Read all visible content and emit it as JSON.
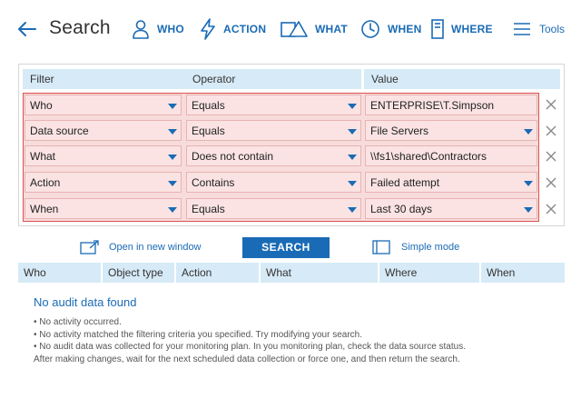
{
  "header": {
    "title": "Search",
    "nav": {
      "who": "WHO",
      "action": "ACTION",
      "what": "WHAT",
      "when": "WHEN",
      "where": "WHERE",
      "tools": "Tools"
    }
  },
  "filters": {
    "columns": {
      "filter": "Filter",
      "operator": "Operator",
      "value": "Value"
    },
    "rows": [
      {
        "filter": "Who",
        "operator": "Equals",
        "value": "ENTERPRISE\\T.Simpson",
        "value_dropdown": false
      },
      {
        "filter": "Data source",
        "operator": "Equals",
        "value": "File Servers",
        "value_dropdown": true
      },
      {
        "filter": "What",
        "operator": "Does not contain",
        "value": "\\\\fs1\\shared\\Contractors",
        "value_dropdown": false
      },
      {
        "filter": "Action",
        "operator": "Contains",
        "value": "Failed attempt",
        "value_dropdown": true
      },
      {
        "filter": "When",
        "operator": "Equals",
        "value": "Last 30 days",
        "value_dropdown": true
      }
    ]
  },
  "actions": {
    "open_new_window": "Open in new window",
    "search": "SEARCH",
    "simple_mode": "Simple mode"
  },
  "results": {
    "columns": {
      "who": "Who",
      "object_type": "Object type",
      "action": "Action",
      "what": "What",
      "where": "Where",
      "when": "When"
    },
    "empty_title": "No audit data found",
    "empty_lines": [
      "• No activity occurred.",
      "• No activity matched the filtering criteria you specified. Try modifying your search.",
      "• No audit data was collected for your monitoring plan. In you monitoring plan, check the data source status.",
      "After making changes, wait for the next scheduled data collection or force one, and then return the search."
    ]
  },
  "colors": {
    "accent": "#1a6bb5",
    "header_fill": "#d7eaf7",
    "row_fill": "#f8dcdc",
    "row_border": "#d9534f"
  }
}
